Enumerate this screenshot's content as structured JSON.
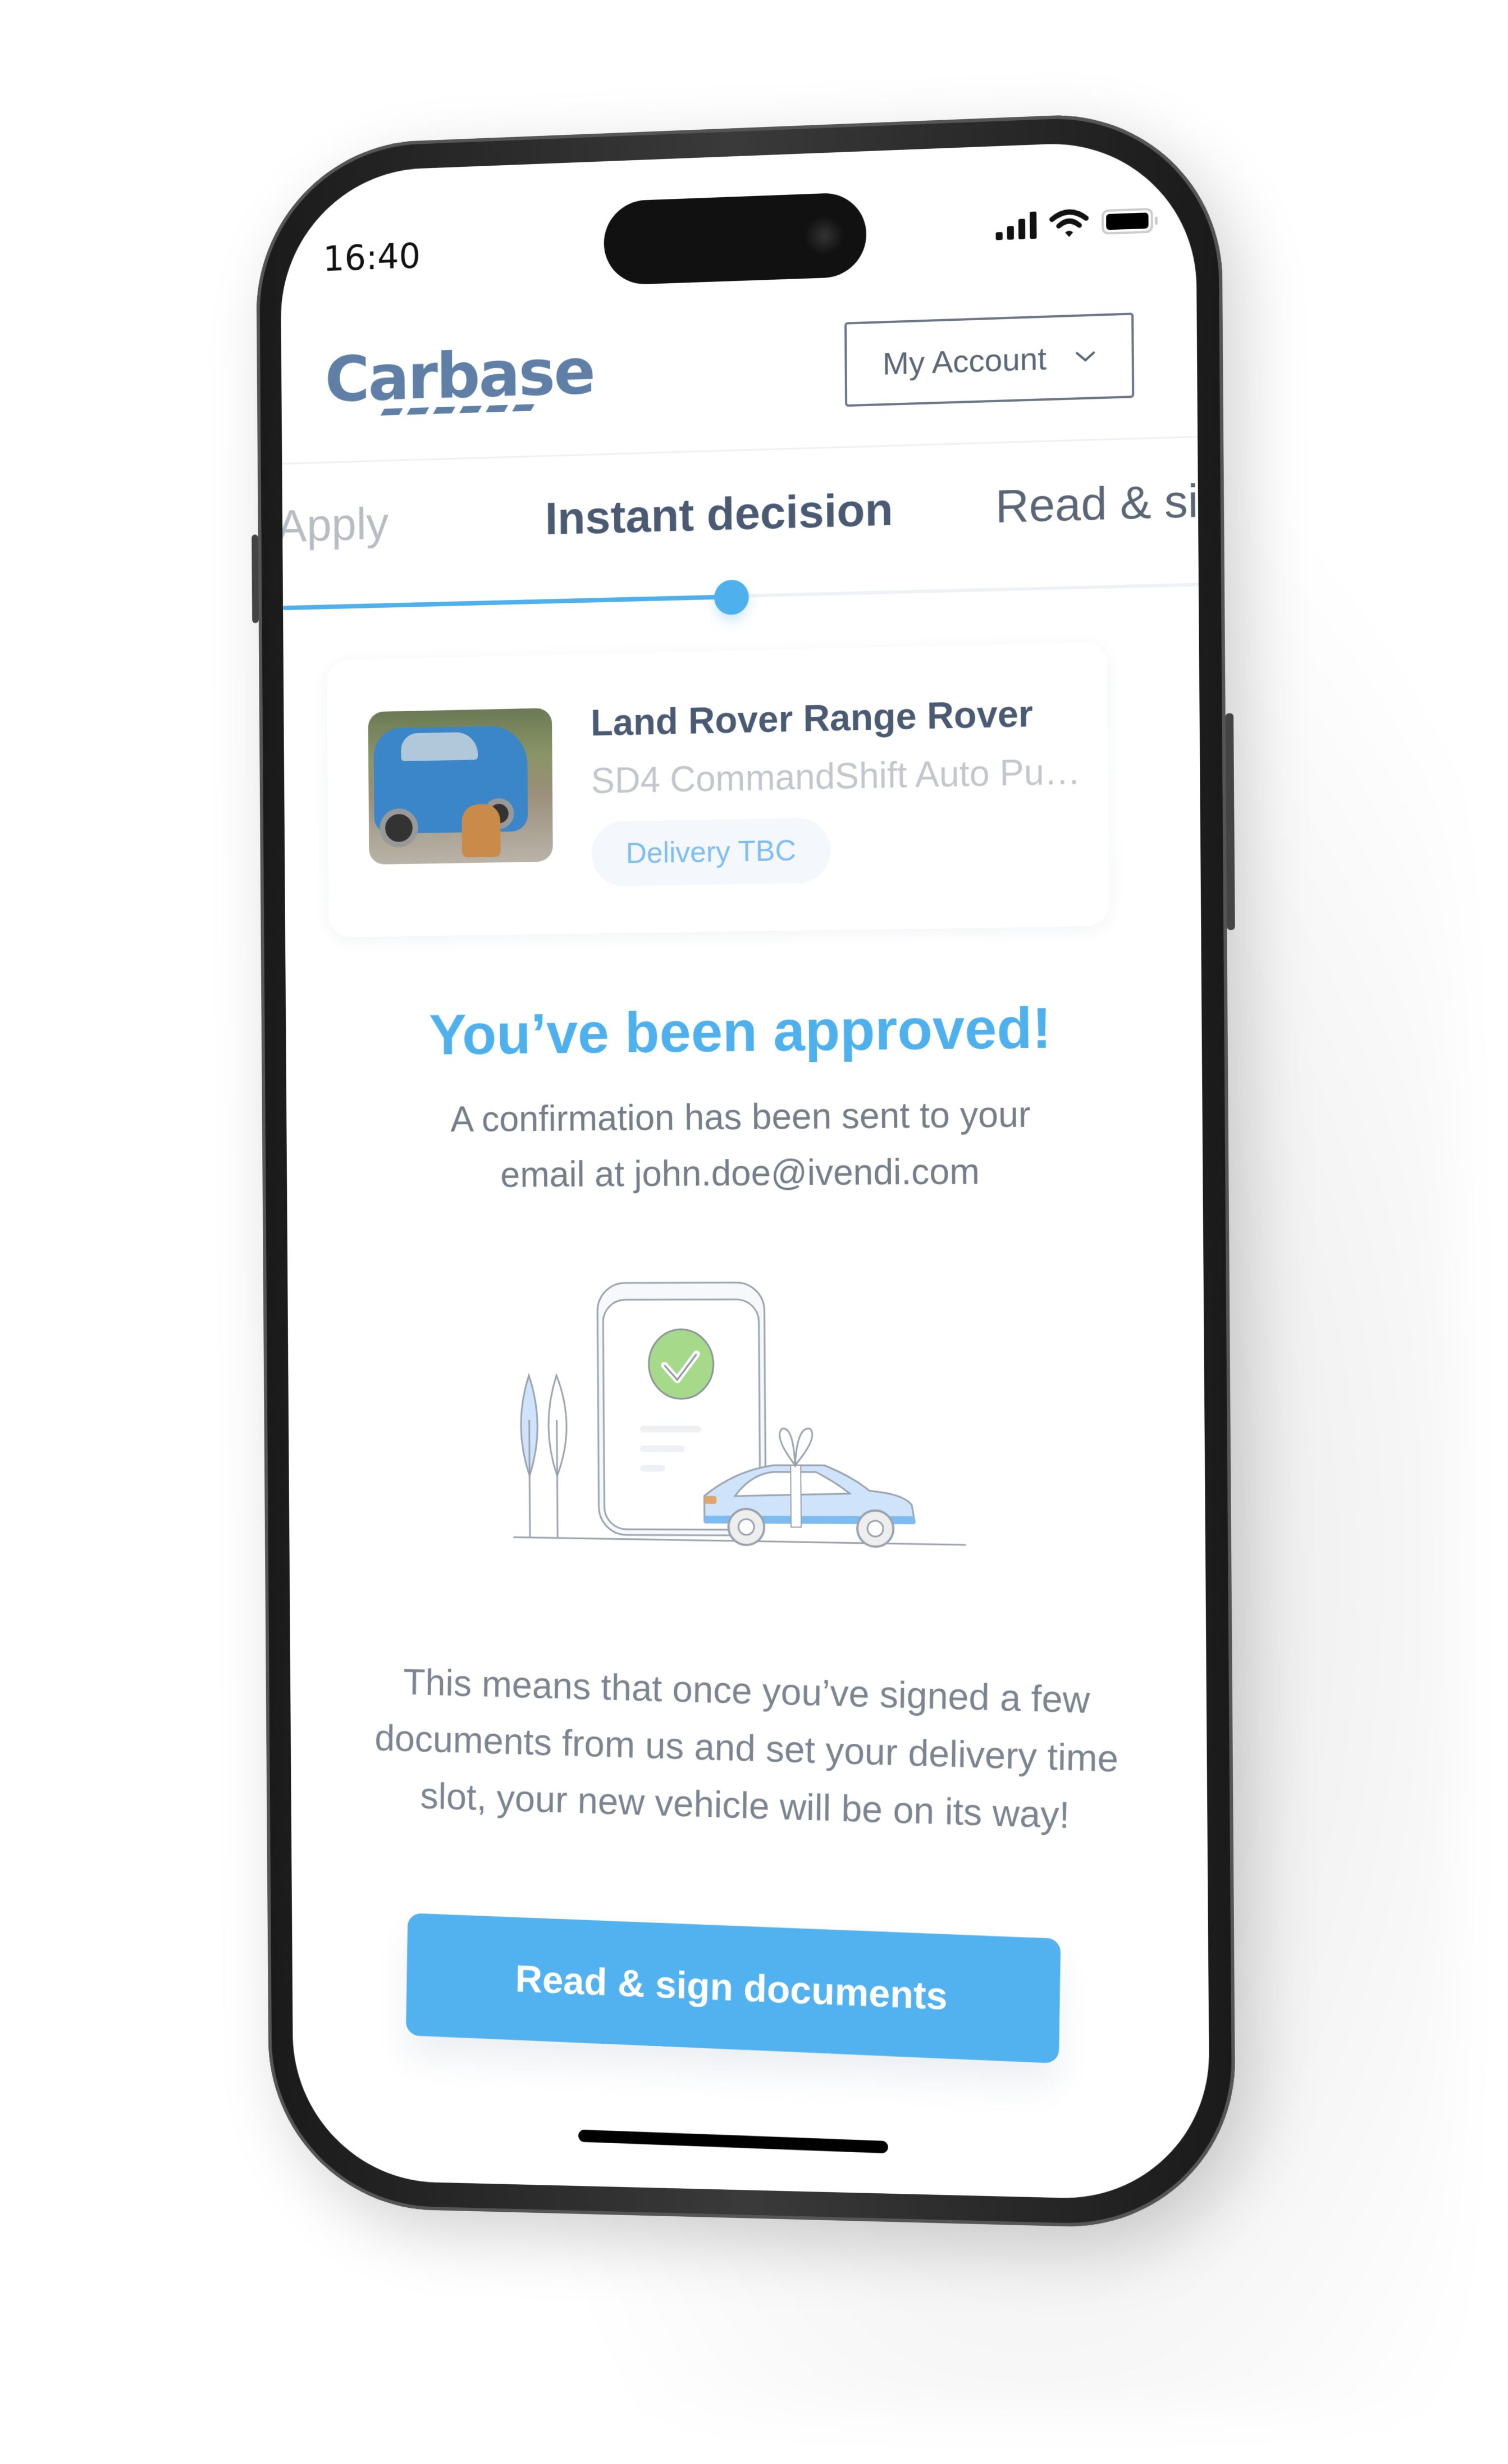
{
  "status_bar": {
    "time": "16:40",
    "icons": [
      "signal-icon",
      "wifi-icon",
      "battery-icon"
    ]
  },
  "header": {
    "logo_text": "Carbase",
    "account_button": {
      "label": "My Account",
      "icon": "chevron-down-icon"
    }
  },
  "steps": {
    "items": [
      {
        "label": "Apply",
        "state": "completed"
      },
      {
        "label": "Instant decision",
        "state": "current"
      },
      {
        "label": "Read & si",
        "state": "upcoming"
      }
    ],
    "progress_percent": 50
  },
  "vehicle": {
    "title": "Land Rover Range Rover",
    "subtitle": "SD4 CommandShift Auto Pu…",
    "badge": "Delivery TBC"
  },
  "result": {
    "heading": "You’ve been approved!",
    "confirmation_line1": "A confirmation has been sent to your",
    "confirmation_line2": "email at john.doe@ivendi.com",
    "explanation": "This means that once you’ve signed a few documents from us and set your delivery time slot, your new vehicle will be on its way!"
  },
  "cta": {
    "label": "Read & sign documents"
  },
  "colors": {
    "accent": "#52b1ef",
    "brand": "#5f7fa6",
    "heading_text": "#4a5a72",
    "success": "#a6d98a"
  }
}
